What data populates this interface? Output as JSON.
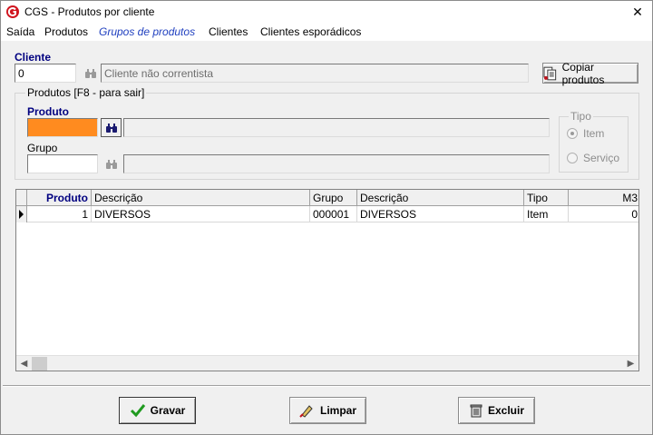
{
  "window": {
    "title": "CGS - Produtos por cliente",
    "close_glyph": "✕"
  },
  "menu": {
    "items": [
      {
        "label": "Saída"
      },
      {
        "label": "Produtos"
      },
      {
        "label": "Grupos de produtos"
      },
      {
        "label": "Clientes"
      },
      {
        "label": "Clientes esporádicos"
      }
    ],
    "active_index": 2
  },
  "cliente": {
    "label": "Cliente",
    "code_value": "0",
    "name_value": "Cliente não correntista",
    "copy_button_label": "Copiar produtos"
  },
  "produtos_group": {
    "title": "Produtos [F8 - para sair]",
    "produto_label": "Produto",
    "produto_value": "",
    "produto_desc": "",
    "grupo_label": "Grupo",
    "grupo_value": "",
    "grupo_desc": ""
  },
  "tipo_group": {
    "title": "Tipo",
    "options": [
      {
        "label": "Item",
        "checked": true
      },
      {
        "label": "Serviço",
        "checked": false
      }
    ]
  },
  "grid": {
    "columns": [
      "Produto",
      "Descrição",
      "Grupo",
      "Descrição",
      "Tipo",
      "M3"
    ],
    "rows": [
      {
        "produto": "1",
        "descricao": "DIVERSOS",
        "grupo": "000001",
        "grupo_desc": "DIVERSOS",
        "tipo": "Item",
        "m3": "0"
      }
    ]
  },
  "buttons": {
    "gravar": "Gravar",
    "limpar": "Limpar",
    "excluir": "Excluir"
  },
  "colors": {
    "accent_orange": "#ff8b1f",
    "label_blue": "#000080",
    "menu_active": "#1f3fbf"
  }
}
